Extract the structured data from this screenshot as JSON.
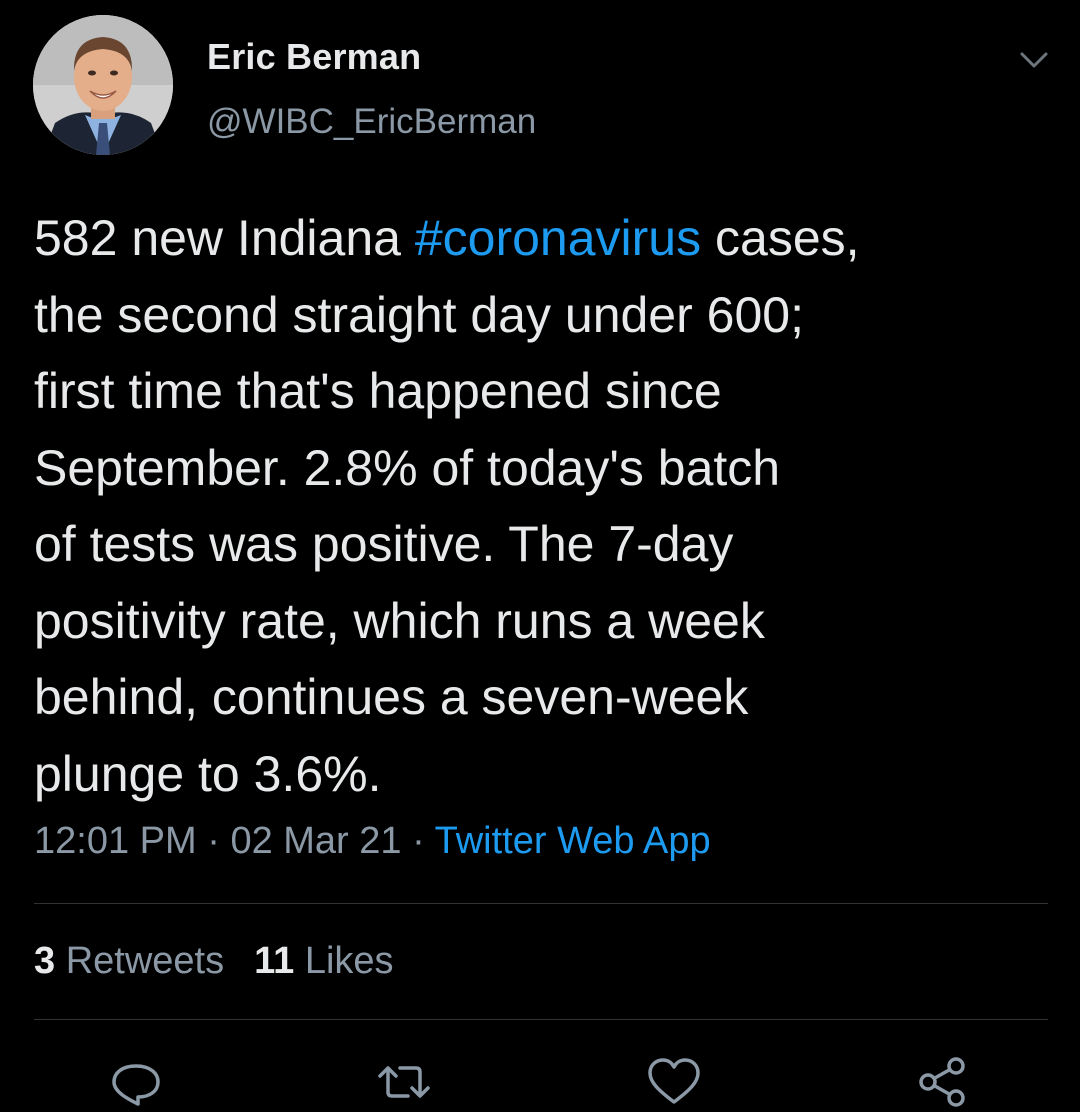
{
  "tweet": {
    "author": {
      "display_name": "Eric Berman",
      "handle": "@WIBC_EricBerman",
      "avatar_icon": "profile-photo"
    },
    "text": {
      "part1": "582 new Indiana ",
      "hashtag": "#coronavirus",
      "part2": " cases,\nthe second straight day under 600;\nfirst time that's happened since\nSeptember. 2.8% of today's batch\nof tests was positive. The 7-day\npositivity rate, which runs a week\nbehind, continues a seven-week\nplunge to 3.6%."
    },
    "time": "12:01 PM",
    "separator": " · ",
    "date": "02 Mar 21",
    "source": "Twitter Web App",
    "stats": {
      "retweets_count": "3",
      "retweets_label": " Retweets",
      "likes_count": "11",
      "likes_label": " Likes"
    },
    "actions": {
      "reply_icon": "reply-icon",
      "retweet_icon": "retweet-icon",
      "like_icon": "heart-icon",
      "share_icon": "share-icon"
    },
    "more_icon": "chevron-down-icon"
  },
  "colors": {
    "background": "#000000",
    "text": "#e7e9ea",
    "secondary": "#8b98a5",
    "accent": "#1d9bf0",
    "divider": "#2f3336"
  }
}
